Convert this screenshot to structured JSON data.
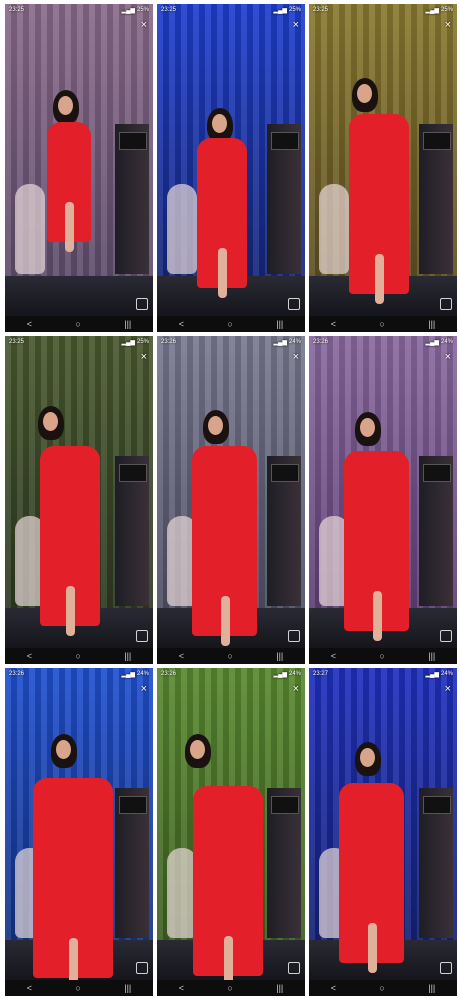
{
  "tiles": [
    {
      "time": "23:25",
      "battery": "25%",
      "bg": [
        "#8a6b8a",
        "#5a4a6a"
      ]
    },
    {
      "time": "23:25",
      "battery": "25%",
      "bg": [
        "#1f3fd0",
        "#15246e"
      ]
    },
    {
      "time": "23:25",
      "battery": "25%",
      "bg": [
        "#8a7a30",
        "#5a4a20"
      ]
    },
    {
      "time": "23:25",
      "battery": "25%",
      "bg": [
        "#4a5a30",
        "#2a3520"
      ]
    },
    {
      "time": "23:26",
      "battery": "24%",
      "bg": [
        "#7a7a90",
        "#4a4a60"
      ]
    },
    {
      "time": "23:26",
      "battery": "24%",
      "bg": [
        "#8a6aa0",
        "#5a3a70"
      ]
    },
    {
      "time": "23:26",
      "battery": "24%",
      "bg": [
        "#2050d0",
        "#14307a"
      ]
    },
    {
      "time": "23:26",
      "battery": "24%",
      "bg": [
        "#5a8a30",
        "#3a5a20"
      ]
    },
    {
      "time": "23:27",
      "battery": "24%",
      "bg": [
        "#2030c0",
        "#14206a"
      ]
    }
  ],
  "icons": {
    "close": "×",
    "back": "<",
    "home": "○",
    "recents": "|||"
  },
  "colors": {
    "dress": "#e3202a",
    "navbar": "#0d0d0d"
  }
}
